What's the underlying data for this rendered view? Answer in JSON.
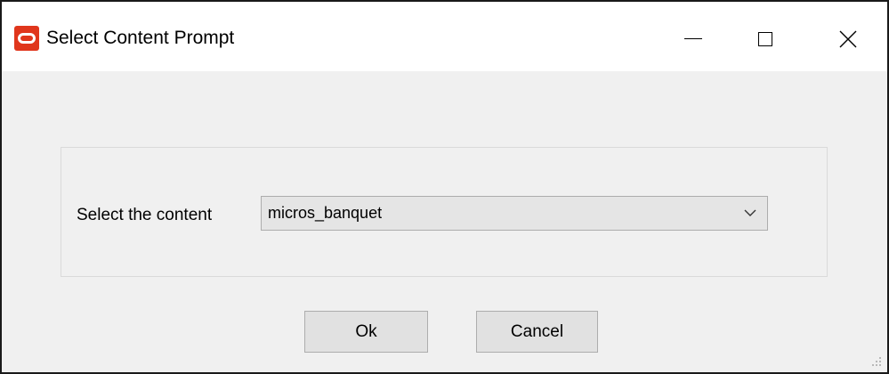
{
  "window": {
    "title": "Select Content Prompt",
    "icon": "oracle-logo-icon",
    "controls": [
      "minimize-icon",
      "maximize-icon",
      "close-icon"
    ]
  },
  "form": {
    "content_label": "Select the content",
    "content_selected": "micros_banquet"
  },
  "buttons": {
    "ok_label": "Ok",
    "cancel_label": "Cancel"
  },
  "colors": {
    "brand_red": "#e0361c",
    "dialog_background": "#f0f0f0",
    "titlebar_background": "#ffffff"
  }
}
